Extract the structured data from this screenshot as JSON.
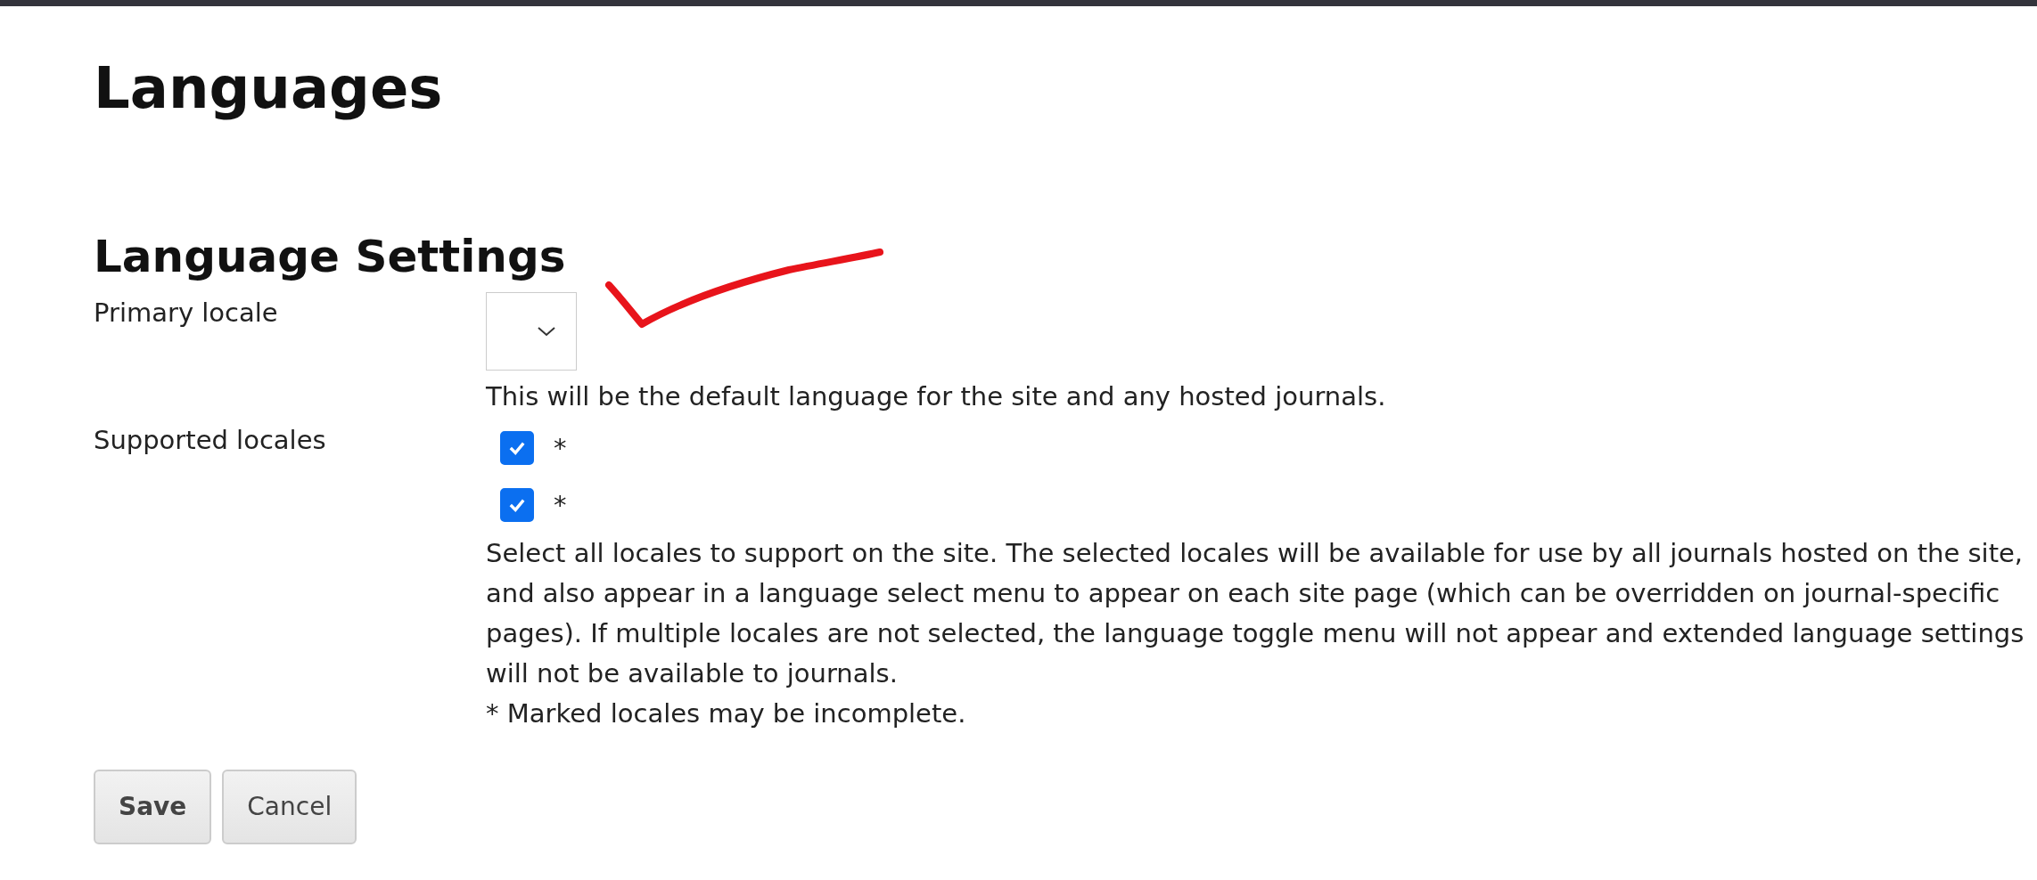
{
  "page_title": "Languages",
  "section_title": "Language Settings",
  "primary_locale": {
    "label": "Primary locale",
    "help": "This will be the default language for the site and any hosted journals."
  },
  "supported_locales": {
    "label": "Supported locales",
    "items": [
      {
        "marker": "*",
        "checked": true
      },
      {
        "marker": "*",
        "checked": true
      }
    ],
    "help": "Select all locales to support on the site. The selected locales will be available for use by all journals hosted on the site, and also appear in a language select menu to appear on each site page (which can be overridden on journal-specific pages). If multiple locales are not selected, the language toggle menu will not appear and extended language settings will not be available to journals.",
    "note": "* Marked locales may be incomplete."
  },
  "buttons": [
    {
      "label": "Save",
      "kind": "primary"
    },
    {
      "label": "Cancel",
      "kind": "secondary"
    }
  ]
}
